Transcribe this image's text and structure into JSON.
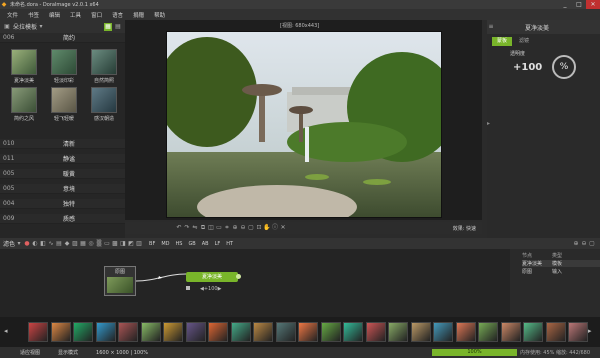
{
  "titlebar": {
    "app_title": "未命名.dora - DoraImage v2.0.1 x64",
    "minimize": "_",
    "maximize": "□",
    "close": "✕"
  },
  "menu": [
    "文件",
    "书签",
    "编辑",
    "工具",
    "窗口",
    "语言",
    "捐赠",
    "帮助"
  ],
  "left": {
    "preset_label": "朵拉模板",
    "groups_top": [
      {
        "num": "006",
        "name": "简约"
      }
    ],
    "thumbs": [
      {
        "label": "夏净淡美",
        "color": "#6c8a5a"
      },
      {
        "label": "轻淡印彩",
        "color": "#3e6a48"
      },
      {
        "label": "自然简照",
        "color": "#4a6f5f"
      },
      {
        "label": "简约之风",
        "color": "#5d7356"
      },
      {
        "label": "轻飞轻暖",
        "color": "#7b7b6a"
      },
      {
        "label": "感汉朝造",
        "color": "#3d5560"
      }
    ],
    "groups_bottom": [
      {
        "num": "010",
        "name": "清新"
      },
      {
        "num": "011",
        "name": "静谧"
      },
      {
        "num": "005",
        "name": "暖黄"
      },
      {
        "num": "005",
        "name": "意境"
      },
      {
        "num": "004",
        "name": "独特"
      },
      {
        "num": "009",
        "name": "质感"
      }
    ]
  },
  "viewer": {
    "size_label": "[视图: 680x443]",
    "mode_label": "效果: 快速"
  },
  "right": {
    "preset_name": "夏净淡美",
    "tabs": [
      "蒙板",
      "滤镜"
    ],
    "opacity_label": "透明度",
    "opacity_value": "+100",
    "percent": "%"
  },
  "filterbar": {
    "label": "滤色",
    "chips": [
      "BF",
      "MD",
      "HS",
      "GB",
      "AB",
      "LF",
      "HT"
    ]
  },
  "nodes": {
    "source_label": "原图",
    "effect_label": "夏净淡美",
    "effect_value": "◀+100▶"
  },
  "nodeinfo": {
    "headers": [
      "节点",
      "类型"
    ],
    "rows": [
      [
        "夏净淡美",
        "模板"
      ],
      [
        "原图",
        "输入"
      ]
    ]
  },
  "status": {
    "zoom_mode": "适应视图",
    "view_mode": "显示模式",
    "dims": "1600 × 1000 | 100%",
    "progress": "100%",
    "memory": "内存使用: 45%  缩放: 442/680"
  },
  "colors": {
    "accent": "#79b52a",
    "bg": "#2b2b2b"
  }
}
